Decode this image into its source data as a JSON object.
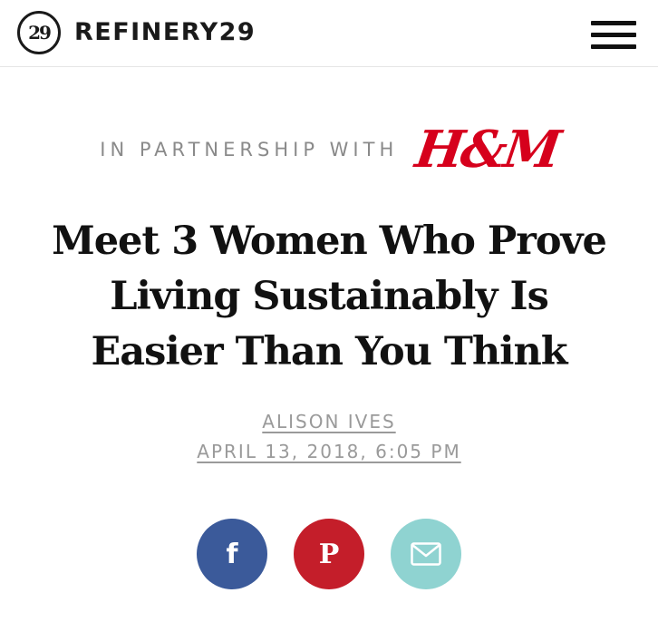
{
  "header": {
    "logo_badge": "29",
    "brand_name": "REFINERY29"
  },
  "partnership": {
    "label": "IN PARTNERSHIP WITH",
    "partner_logo": "H&M"
  },
  "article": {
    "headline_lines": [
      "Meet 3 Women Who Prove",
      "Living Sustainably Is",
      "Easier Than You Think"
    ],
    "author": "ALISON IVES",
    "date": "APRIL 13, 2018, 6:05 PM"
  },
  "share": {
    "facebook_glyph": "f",
    "pinterest_glyph": "P",
    "facebook_icon": "facebook-icon",
    "pinterest_icon": "pinterest-icon",
    "email_icon": "mail-icon"
  },
  "colors": {
    "facebook": "#3b5a9a",
    "pinterest": "#c41e2a",
    "email": "#8fd3d1",
    "partner_logo": "#d6001c",
    "meta_text": "#9a9a9a"
  }
}
